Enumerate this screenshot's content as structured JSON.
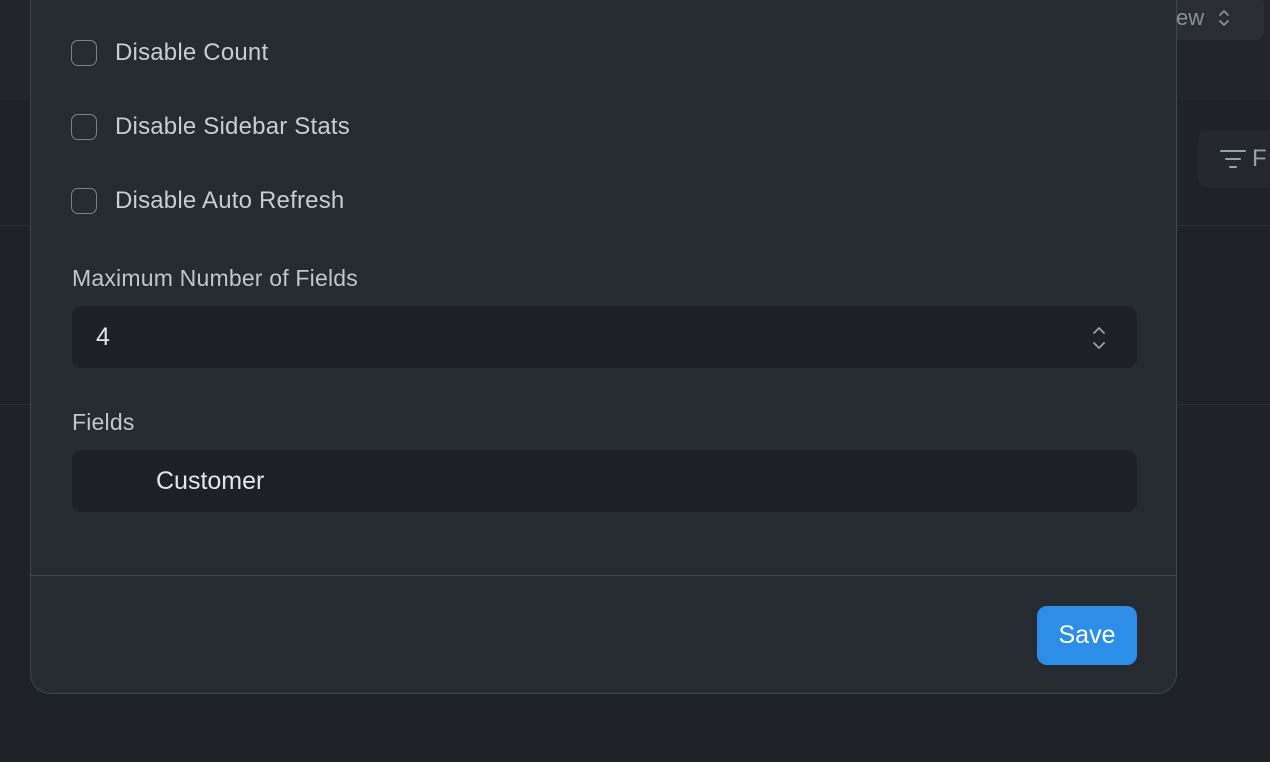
{
  "background": {
    "view_select_label": "ew",
    "filter_button_label": "F"
  },
  "modal": {
    "checkboxes": [
      {
        "label": "Disable Count",
        "checked": false
      },
      {
        "label": "Disable Sidebar Stats",
        "checked": false
      },
      {
        "label": "Disable Auto Refresh",
        "checked": false
      }
    ],
    "max_fields": {
      "label": "Maximum Number of Fields",
      "value": "4"
    },
    "fields": {
      "label": "Fields",
      "value": "Customer"
    },
    "save_label": "Save"
  },
  "colors": {
    "accent": "#2c8ee8",
    "modal_bg": "#262a31",
    "input_bg": "#1d2025"
  }
}
